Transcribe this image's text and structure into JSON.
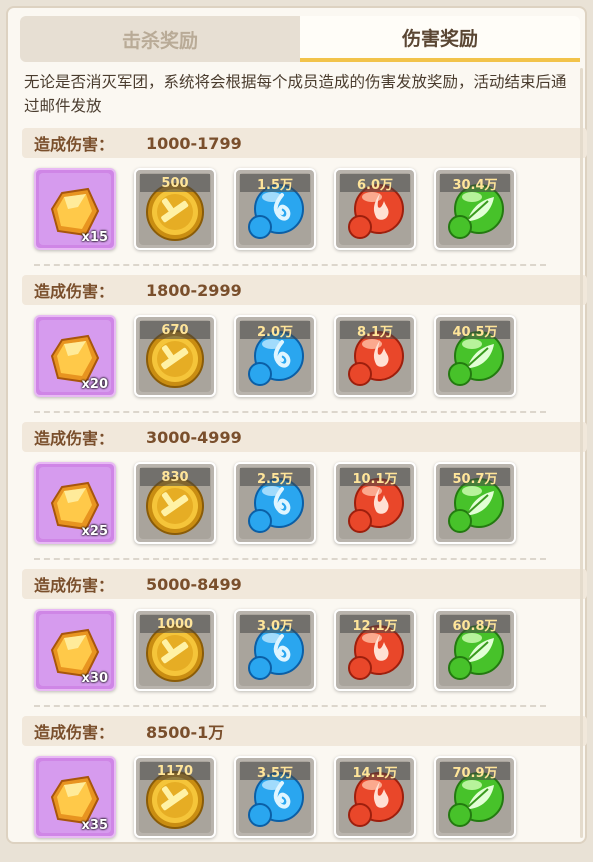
{
  "tabs": [
    {
      "label": "击杀奖励",
      "active": false
    },
    {
      "label": "伤害奖励",
      "active": true
    }
  ],
  "description": "无论是否消灭军团，系统将会根据每个成员造成的伤害发放奖励，活动结束后通过邮件发放",
  "tiers": [
    {
      "label": "造成伤害：",
      "range": "1000-1799",
      "gem_count": "x15",
      "gold": "500",
      "water": "1.5万",
      "fire": "6.0万",
      "leaf": "30.4万"
    },
    {
      "label": "造成伤害：",
      "range": "1800-2999",
      "gem_count": "x20",
      "gold": "670",
      "water": "2.0万",
      "fire": "8.1万",
      "leaf": "40.5万"
    },
    {
      "label": "造成伤害：",
      "range": "3000-4999",
      "gem_count": "x25",
      "gold": "830",
      "water": "2.5万",
      "fire": "10.1万",
      "leaf": "50.7万"
    },
    {
      "label": "造成伤害：",
      "range": "5000-8499",
      "gem_count": "x30",
      "gold": "1000",
      "water": "3.0万",
      "fire": "12.1万",
      "leaf": "60.8万"
    },
    {
      "label": "造成伤害：",
      "range": "8500-1万",
      "gem_count": "x35",
      "gold": "1170",
      "water": "3.5万",
      "fire": "14.1万",
      "leaf": "70.9万"
    }
  ],
  "icons": {
    "gem": "orange-gem-icon",
    "gold": "gold-coin-icon",
    "water": "blue-water-orb-icon",
    "fire": "red-fire-orb-icon",
    "leaf": "green-leaf-orb-icon"
  },
  "colors": {
    "gold": "#f2c34a",
    "water": "#2aa6ef",
    "fire": "#e9472a",
    "leaf": "#47c22a",
    "gem": "#f0a72b",
    "purple_bg": "#cf86e6"
  }
}
